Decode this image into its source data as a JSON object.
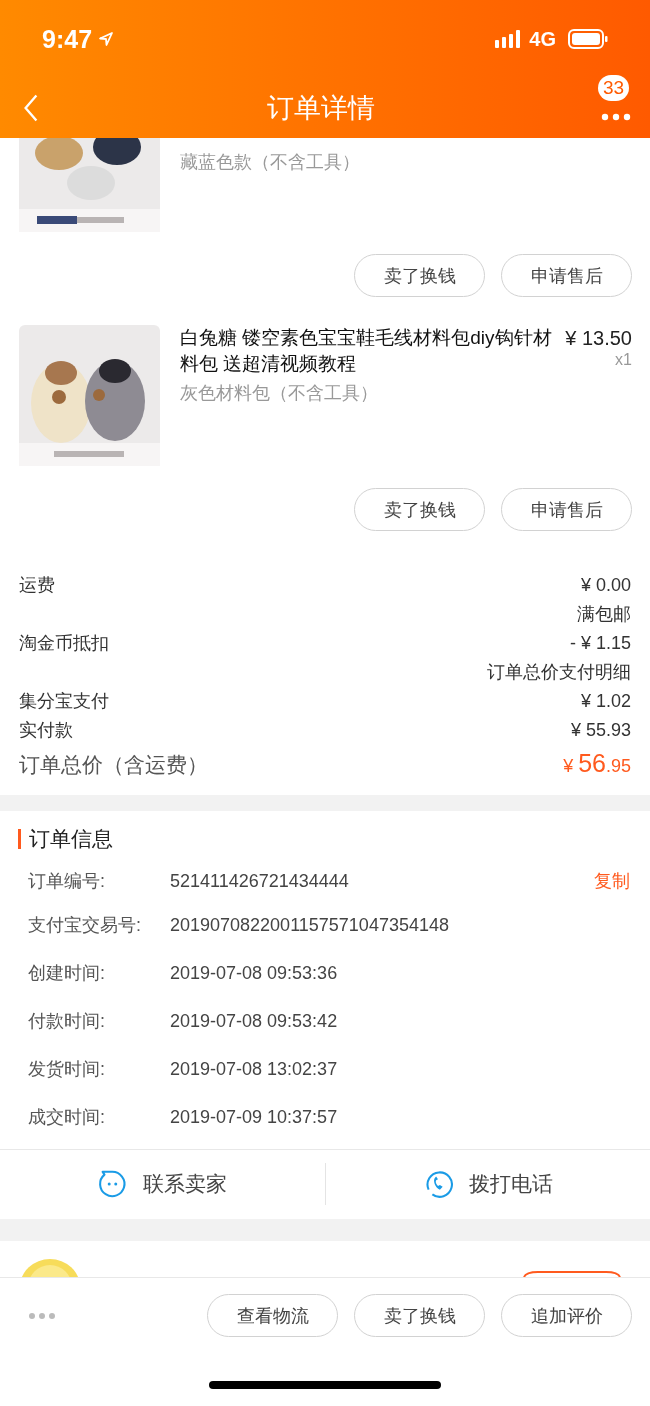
{
  "status_bar": {
    "time": "9:47",
    "network": "4G"
  },
  "nav": {
    "title": "订单详情",
    "badge": "33"
  },
  "items": [
    {
      "kind": "partial",
      "variant": "藏蓝色款（不含工具）",
      "actions": [
        "卖了换钱",
        "申请售后"
      ]
    },
    {
      "kind": "full",
      "title": "白兔糖 镂空素色宝宝鞋毛线材料包diy钩针材料包 送超清视频教程",
      "price": "¥ 13.50",
      "quantity": "x1",
      "variant": "灰色材料包（不含工具）",
      "actions": [
        "卖了换钱",
        "申请售后"
      ]
    }
  ],
  "summary": [
    {
      "kind": "line",
      "label": "运费",
      "value": "¥ 0.00"
    },
    {
      "kind": "note",
      "value": "满包邮"
    },
    {
      "kind": "line",
      "label": "淘金币抵扣",
      "value": "- ¥ 1.15"
    },
    {
      "kind": "note",
      "value": "订单总价支付明细"
    },
    {
      "kind": "line",
      "label": "集分宝支付",
      "value": "¥ 1.02"
    },
    {
      "kind": "line",
      "label": "实付款",
      "value": "¥ 55.93"
    }
  ],
  "total": {
    "label": "订单总价（含运费）",
    "currency": "¥",
    "integer": "56",
    "decimal": ".95"
  },
  "order_info": {
    "title": "订单信息",
    "rows": [
      {
        "label": "订单编号:",
        "value": "521411426721434444",
        "action": "复制"
      },
      {
        "label": "支付宝交易号:",
        "value": "2019070822001157571047354148"
      },
      {
        "label": "创建时间:",
        "value": "2019-07-08 09:53:36"
      },
      {
        "label": "付款时间:",
        "value": "2019-07-08 09:53:42"
      },
      {
        "label": "发货时间:",
        "value": "2019-07-08 13:02:37"
      },
      {
        "label": "成交时间:",
        "value": "2019-07-09 10:37:57"
      }
    ]
  },
  "contact": [
    {
      "kind": "chat",
      "label": "联系卖家"
    },
    {
      "kind": "phone",
      "label": "拨打电话"
    }
  ],
  "bottom_bar": {
    "actions": [
      "查看物流",
      "卖了换钱",
      "追加评价"
    ]
  }
}
